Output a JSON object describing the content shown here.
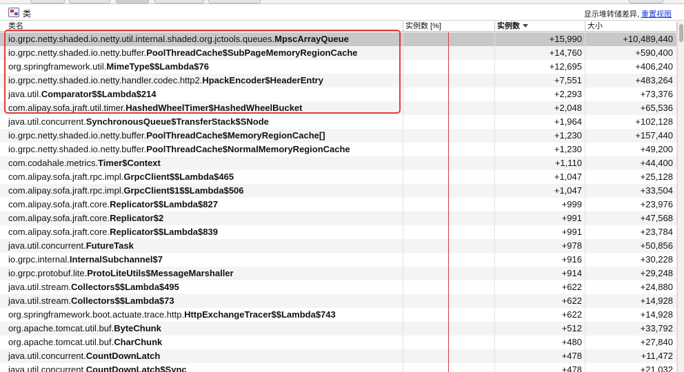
{
  "panel": {
    "title": "类",
    "links_prefix": "显示堆转储差异,",
    "reset_view": "重置视图"
  },
  "columns": {
    "name": "类名",
    "pct": "实例数 [%]",
    "count": "实例数",
    "size": "大小"
  },
  "colors": {
    "highlight": "#e23b3b",
    "link": "#1a3fd6",
    "selected_row": "#c8c8c8"
  },
  "rows": [
    {
      "pkg": "io.grpc.netty.shaded.io.netty.util.internal.shaded.org.jctools.queues.",
      "cls": "MpscArrayQueue",
      "count": "+15,990",
      "size": "+10,489,440"
    },
    {
      "pkg": "io.grpc.netty.shaded.io.netty.buffer.",
      "cls": "PoolThreadCache$SubPageMemoryRegionCache",
      "count": "+14,760",
      "size": "+590,400"
    },
    {
      "pkg": "org.springframework.util.",
      "cls": "MimeType$$Lambda$76",
      "count": "+12,695",
      "size": "+406,240"
    },
    {
      "pkg": "io.grpc.netty.shaded.io.netty.handler.codec.http2.",
      "cls": "HpackEncoder$HeaderEntry",
      "count": "+7,551",
      "size": "+483,264"
    },
    {
      "pkg": "java.util.",
      "cls": "Comparator$$Lambda$214",
      "count": "+2,293",
      "size": "+73,376"
    },
    {
      "pkg": "com.alipay.sofa.jraft.util.timer.",
      "cls": "HashedWheelTimer$HashedWheelBucket",
      "count": "+2,048",
      "size": "+65,536"
    },
    {
      "pkg": "java.util.concurrent.",
      "cls": "SynchronousQueue$TransferStack$SNode",
      "count": "+1,964",
      "size": "+102,128"
    },
    {
      "pkg": "io.grpc.netty.shaded.io.netty.buffer.",
      "cls": "PoolThreadCache$MemoryRegionCache[]",
      "count": "+1,230",
      "size": "+157,440"
    },
    {
      "pkg": "io.grpc.netty.shaded.io.netty.buffer.",
      "cls": "PoolThreadCache$NormalMemoryRegionCache",
      "count": "+1,230",
      "size": "+49,200"
    },
    {
      "pkg": "com.codahale.metrics.",
      "cls": "Timer$Context",
      "count": "+1,110",
      "size": "+44,400"
    },
    {
      "pkg": "com.alipay.sofa.jraft.rpc.impl.",
      "cls": "GrpcClient$$Lambda$465",
      "count": "+1,047",
      "size": "+25,128"
    },
    {
      "pkg": "com.alipay.sofa.jraft.rpc.impl.",
      "cls": "GrpcClient$1$$Lambda$506",
      "count": "+1,047",
      "size": "+33,504"
    },
    {
      "pkg": "com.alipay.sofa.jraft.core.",
      "cls": "Replicator$$Lambda$827",
      "count": "+999",
      "size": "+23,976"
    },
    {
      "pkg": "com.alipay.sofa.jraft.core.",
      "cls": "Replicator$2",
      "count": "+991",
      "size": "+47,568"
    },
    {
      "pkg": "com.alipay.sofa.jraft.core.",
      "cls": "Replicator$$Lambda$839",
      "count": "+991",
      "size": "+23,784"
    },
    {
      "pkg": "java.util.concurrent.",
      "cls": "FutureTask",
      "count": "+978",
      "size": "+50,856"
    },
    {
      "pkg": "io.grpc.internal.",
      "cls": "InternalSubchannel$7",
      "count": "+916",
      "size": "+30,228"
    },
    {
      "pkg": "io.grpc.protobuf.lite.",
      "cls": "ProtoLiteUtils$MessageMarshaller",
      "count": "+914",
      "size": "+29,248"
    },
    {
      "pkg": "java.util.stream.",
      "cls": "Collectors$$Lambda$495",
      "count": "+622",
      "size": "+24,880"
    },
    {
      "pkg": "java.util.stream.",
      "cls": "Collectors$$Lambda$73",
      "count": "+622",
      "size": "+14,928"
    },
    {
      "pkg": "org.springframework.boot.actuate.trace.http.",
      "cls": "HttpExchangeTracer$$Lambda$743",
      "count": "+622",
      "size": "+14,928"
    },
    {
      "pkg": "org.apache.tomcat.util.buf.",
      "cls": "ByteChunk",
      "count": "+512",
      "size": "+33,792"
    },
    {
      "pkg": "org.apache.tomcat.util.buf.",
      "cls": "CharChunk",
      "count": "+480",
      "size": "+27,840"
    },
    {
      "pkg": "java.util.concurrent.",
      "cls": "CountDownLatch",
      "count": "+478",
      "size": "+11,472"
    },
    {
      "pkg": "java.util.concurrent.",
      "cls": "CountDownLatch$Sync",
      "count": "+478",
      "size": "+21,032"
    }
  ]
}
